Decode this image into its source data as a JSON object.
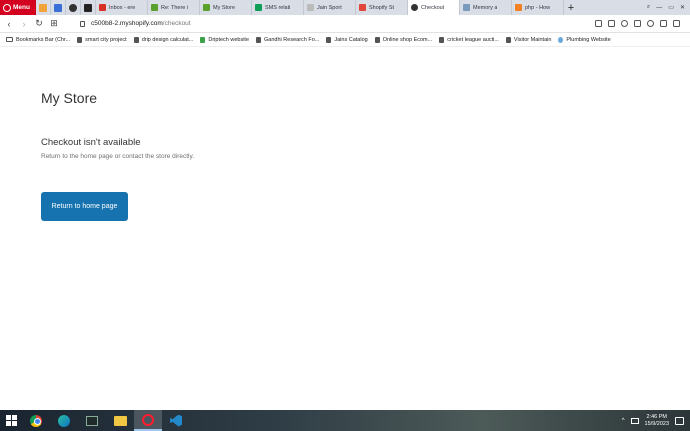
{
  "browser": {
    "menu_label": "Menu",
    "tabs": [
      {
        "title": "Inbox - ere",
        "color": "#d93025"
      },
      {
        "title": "Re: There i",
        "color": "#5aa02c"
      },
      {
        "title": "My Store",
        "color": "#5aa02c"
      },
      {
        "title": "SMS relati",
        "color": "#0f9d58"
      },
      {
        "title": "Jain Sport",
        "color": "#bbbbbb"
      },
      {
        "title": "Shopify St",
        "color": "#e2463a"
      },
      {
        "title": "Checkout",
        "color": "#333333"
      },
      {
        "title": "Memory a",
        "color": "#7a9bbd"
      },
      {
        "title": "php - How",
        "color": "#f48024"
      }
    ],
    "new_tab": "+",
    "url_host": "c500b8-2.myshopify.com",
    "url_path": "/checkout",
    "bookmarks": [
      "Bookmarks Bar (Chr...",
      "smart city project",
      "drip design calculat...",
      "Driptech website",
      "Gandhi Research Fo...",
      "Jains Catalog",
      "Online shop Ecom...",
      "cricket league aucti...",
      "Visitor Maintain",
      "Plumbing Website"
    ]
  },
  "page": {
    "store_name": "My Store",
    "heading": "Checkout isn't available",
    "subtext": "Return to the home page or contact the store directly.",
    "button_label": "Return to home page",
    "button_color": "#1773b0"
  },
  "taskbar": {
    "time": "2:46 PM",
    "date": "15/9/2023"
  }
}
